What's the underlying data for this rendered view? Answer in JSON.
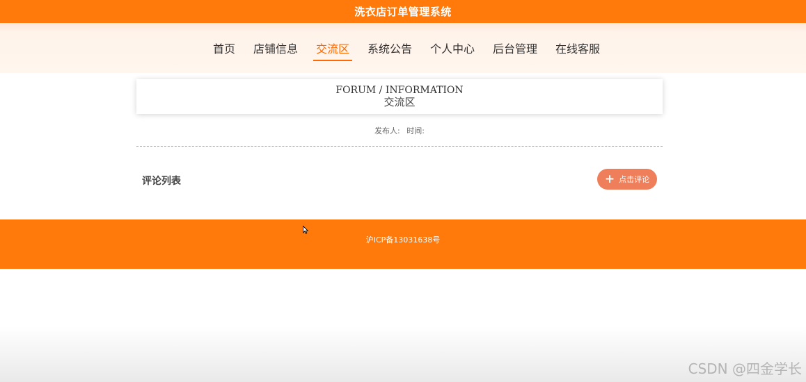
{
  "header": {
    "site_title": "洗衣店订单管理系统"
  },
  "nav": {
    "items": [
      {
        "label": "首页"
      },
      {
        "label": "店铺信息"
      },
      {
        "label": "交流区"
      },
      {
        "label": "系统公告"
      },
      {
        "label": "个人中心"
      },
      {
        "label": "后台管理"
      },
      {
        "label": "在线客服"
      }
    ],
    "active_label": "交流区"
  },
  "page": {
    "en_title": "FORUM / INFORMATION",
    "cn_title": "交流区",
    "publisher_label": "发布人:",
    "time_label": "时间:"
  },
  "comments": {
    "heading": "评论列表",
    "button_label": "点击评论",
    "button_icon": "plus-icon"
  },
  "footer": {
    "icp": "沪ICP备13031638号"
  },
  "watermark": "CSDN @四金学长",
  "colors": {
    "primary": "#ff7a0a",
    "nav_bg": "#fff6ee",
    "active_nav": "#ff6a00",
    "comment_button": "#ef7f5a"
  }
}
